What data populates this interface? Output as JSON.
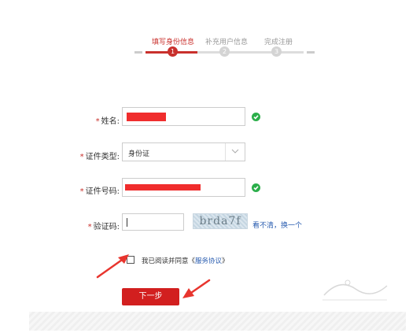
{
  "stepper": {
    "steps": [
      {
        "label": "填写身份信息",
        "number": "1"
      },
      {
        "label": "补充用户信息",
        "number": "2"
      },
      {
        "label": "完成注册",
        "number": "3"
      }
    ]
  },
  "form": {
    "name": {
      "required_mark": "*",
      "label": "姓名:"
    },
    "id_type": {
      "required_mark": "*",
      "label": "证件类型:",
      "selected": "身份证"
    },
    "id_number": {
      "required_mark": "*",
      "label": "证件号码:"
    },
    "captcha": {
      "required_mark": "*",
      "label": "验证码:",
      "image_text": "brda7f",
      "refresh_link": "看不清，换一个"
    }
  },
  "agreement": {
    "text": "我已阅读并同意《",
    "link": "服务协议",
    "close": "》"
  },
  "next_button": {
    "label": "下一步"
  },
  "colors": {
    "accent": "#c9302c",
    "ok": "#2bae4a",
    "button": "#d21f1f",
    "link": "#2a5db0"
  }
}
